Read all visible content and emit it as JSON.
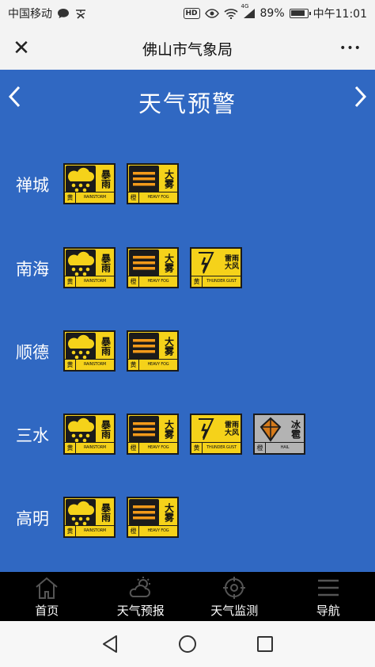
{
  "status_bar": {
    "carrier": "中国移动",
    "hd_label": "HD",
    "signal_label": "4G",
    "battery": "89%",
    "time": "中午11:01"
  },
  "header": {
    "title": "佛山市气象局",
    "close_glyph": "✕",
    "more_glyph": "•••"
  },
  "page": {
    "title": "天气预警",
    "prev_glyph": "‹",
    "next_glyph": "›"
  },
  "districts": [
    {
      "name": "禅城",
      "warnings": [
        {
          "type": "rainstorm",
          "title": "暴雨",
          "level": "黄",
          "en": "RAINSTORM",
          "color": "#f5d21a"
        },
        {
          "type": "fog",
          "title": "大雾",
          "level": "橙",
          "en": "HEAVY FOG",
          "color": "#f5d21a"
        }
      ]
    },
    {
      "name": "南海",
      "warnings": [
        {
          "type": "rainstorm",
          "title": "暴雨",
          "level": "黄",
          "en": "RAINSTORM",
          "color": "#f5d21a"
        },
        {
          "type": "fog",
          "title": "大雾",
          "level": "橙",
          "en": "HEAVY FOG",
          "color": "#f5d21a"
        },
        {
          "type": "thunder",
          "title": "雷雨大风",
          "level": "黄",
          "en": "THUNDER GUST",
          "color": "#f5d21a"
        }
      ]
    },
    {
      "name": "顺德",
      "warnings": [
        {
          "type": "rainstorm",
          "title": "暴雨",
          "level": "黄",
          "en": "RAINSTORM",
          "color": "#f5d21a"
        },
        {
          "type": "fog",
          "title": "大雾",
          "level": "黄",
          "en": "HEAVY FOG",
          "color": "#f5d21a"
        }
      ]
    },
    {
      "name": "三水",
      "warnings": [
        {
          "type": "rainstorm",
          "title": "暴雨",
          "level": "黄",
          "en": "RAINSTORM",
          "color": "#f5d21a"
        },
        {
          "type": "fog",
          "title": "大雾",
          "level": "橙",
          "en": "HEAVY FOG",
          "color": "#f5d21a"
        },
        {
          "type": "thunder",
          "title": "雷雨大风",
          "level": "黄",
          "en": "THUNDER GUST",
          "color": "#f5d21a"
        },
        {
          "type": "hail",
          "title": "冰雹",
          "level": "橙",
          "en": "HAIL",
          "color": "#b3b3b3"
        }
      ]
    },
    {
      "name": "高明",
      "warnings": [
        {
          "type": "rainstorm",
          "title": "暴雨",
          "level": "黄",
          "en": "RAINSTORM",
          "color": "#f5d21a"
        },
        {
          "type": "fog",
          "title": "大雾",
          "level": "橙",
          "en": "HEAVY FOG",
          "color": "#f5d21a"
        }
      ]
    }
  ],
  "tab_bar": {
    "items": [
      {
        "label": "首页",
        "icon": "home-icon"
      },
      {
        "label": "天气预报",
        "icon": "weather-forecast-icon"
      },
      {
        "label": "天气监测",
        "icon": "monitor-target-icon"
      },
      {
        "label": "导航",
        "icon": "menu-icon"
      }
    ]
  },
  "colors": {
    "page_bg": "#3068c2",
    "badge_yellow": "#f5d21a",
    "badge_gray": "#b3b3b3",
    "tab_bar_bg": "#000000"
  }
}
